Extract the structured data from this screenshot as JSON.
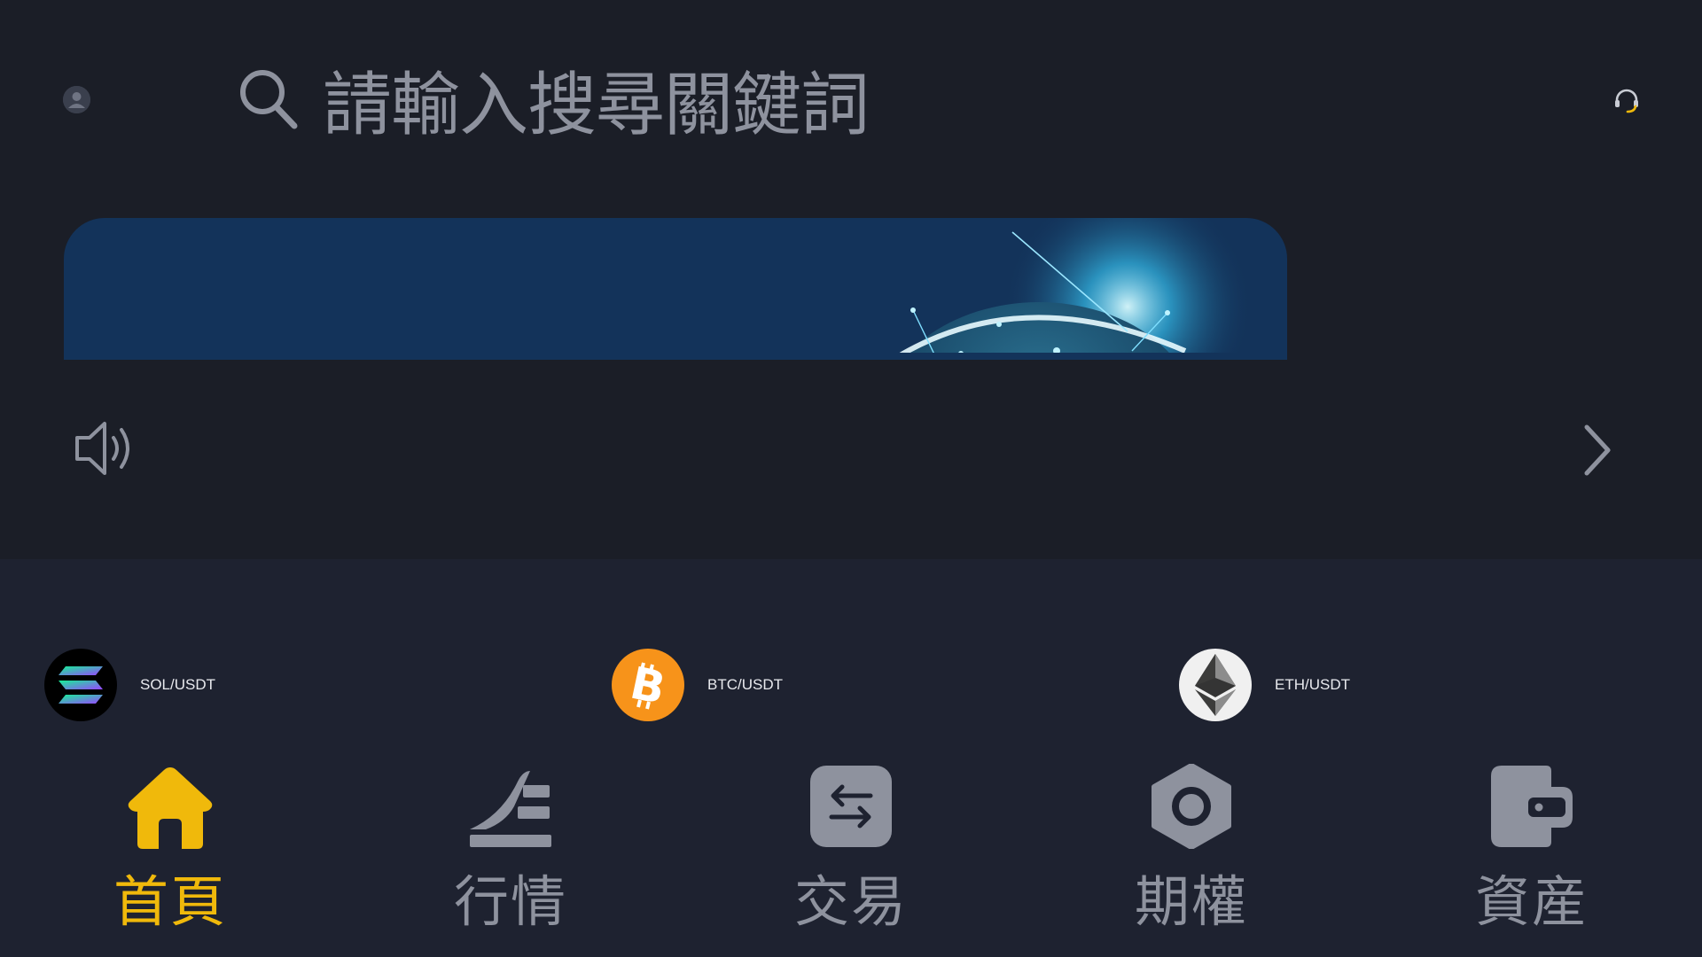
{
  "header": {
    "avatar_icon": "user-avatar-icon",
    "search": {
      "icon": "search-icon",
      "placeholder": "請輸入搜尋關鍵詞"
    },
    "support_icon": "headset-support-icon"
  },
  "banner": {
    "background_color": "#13335a"
  },
  "notice": {
    "speaker_icon": "speaker-icon",
    "chevron_icon": "chevron-right-icon"
  },
  "coins": [
    {
      "pair": "SOL/USDT",
      "icon": "sol-logo-icon"
    },
    {
      "pair": "BTC/USDT",
      "icon": "btc-logo-icon"
    },
    {
      "pair": "ETH/USDT",
      "icon": "eth-logo-icon"
    }
  ],
  "tabbar": {
    "tabs": [
      {
        "label": "首頁",
        "icon": "home-icon",
        "active": true
      },
      {
        "label": "行情",
        "icon": "market-icon",
        "active": false
      },
      {
        "label": "交易",
        "icon": "trade-swap-icon",
        "active": false
      },
      {
        "label": "期權",
        "icon": "options-hexagon-icon",
        "active": false
      },
      {
        "label": "資産",
        "icon": "wallet-icon",
        "active": false
      }
    ]
  },
  "colors": {
    "accent": "#f0b90b",
    "inactive": "#8e929e",
    "top_background": "#1b1e27",
    "bottom_background": "#1e2230"
  }
}
